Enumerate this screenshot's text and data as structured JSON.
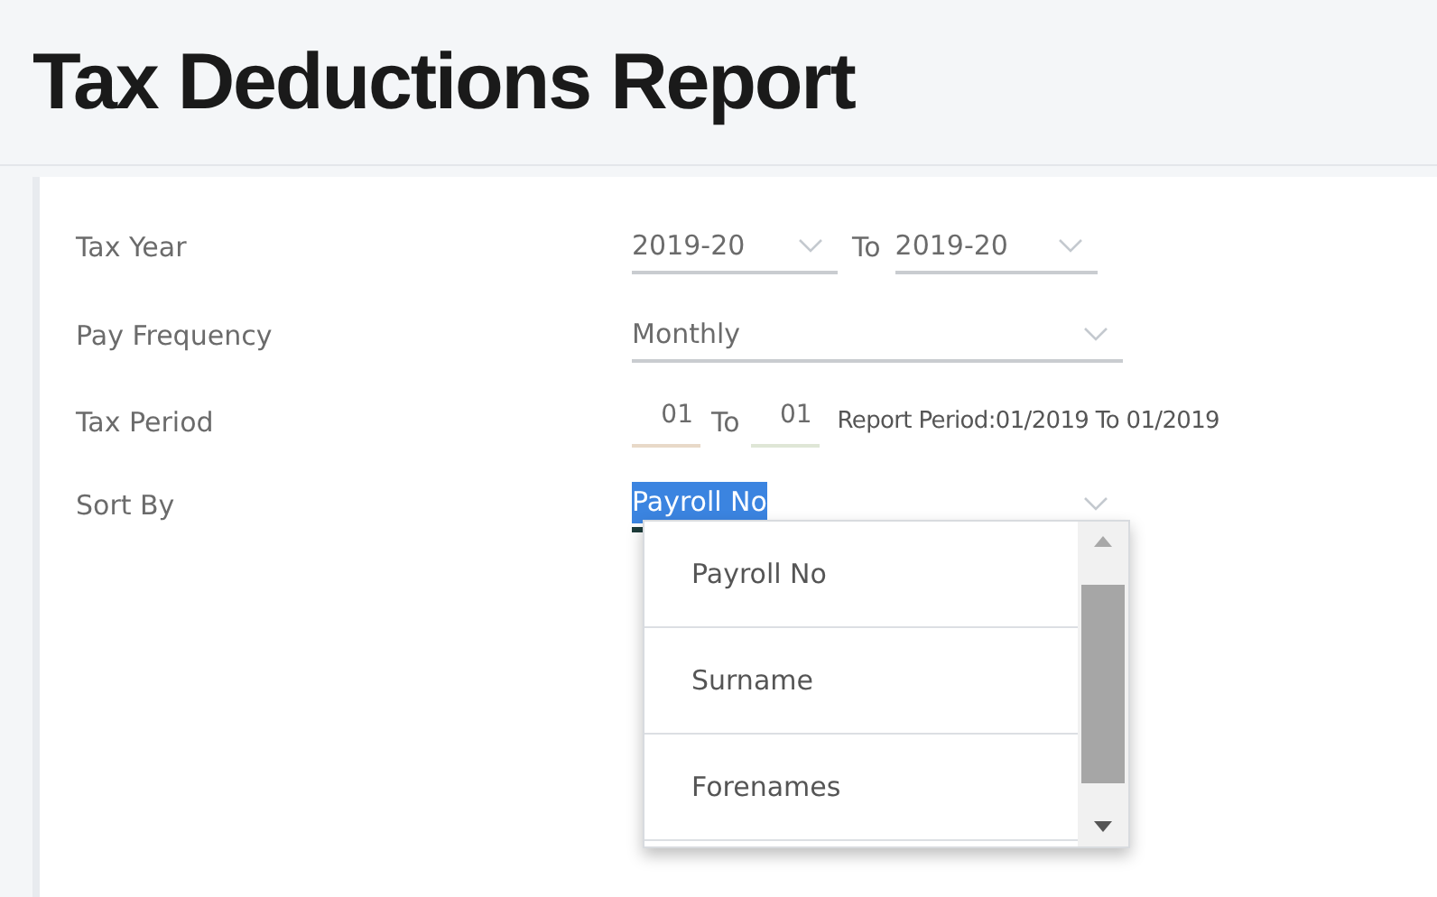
{
  "title": "Tax Deductions Report",
  "tax_year": {
    "label": "Tax Year",
    "from": "2019-20",
    "connector": "To",
    "to": "2019-20"
  },
  "pay_frequency": {
    "label": "Pay Frequency",
    "value": "Monthly"
  },
  "tax_period": {
    "label": "Tax Period",
    "from": "01",
    "connector": "To",
    "to": "01",
    "report_period": "Report Period:01/2019 To 01/2019"
  },
  "sort_by": {
    "label": "Sort By",
    "value": "Payroll No",
    "text_selected": true,
    "expanded": true,
    "options": [
      {
        "label": "Payroll No"
      },
      {
        "label": "Surname"
      },
      {
        "label": "Forenames"
      }
    ]
  }
}
